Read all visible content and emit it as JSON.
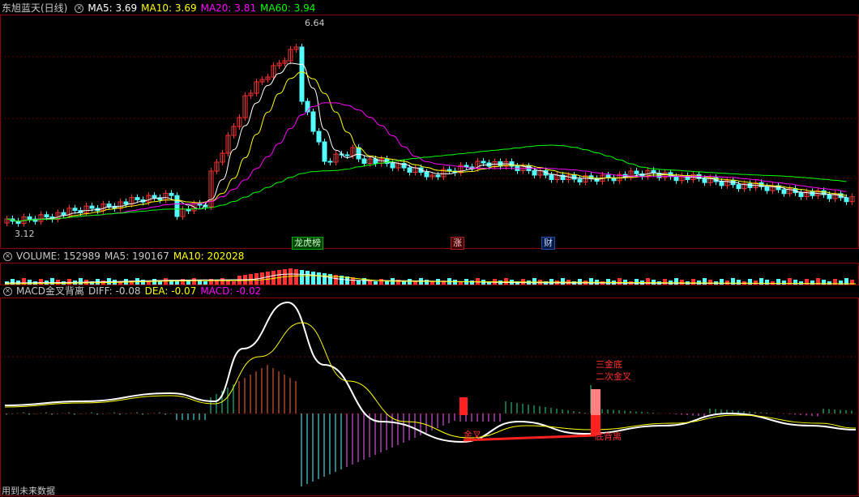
{
  "stock_name": "东旭蓝天(日线)",
  "price_panel": {
    "ma_labels": [
      {
        "name": "MA5:",
        "value": "3.69",
        "color": "#ffffff"
      },
      {
        "name": "MA10:",
        "value": "3.69",
        "color": "#ffff00"
      },
      {
        "name": "MA20:",
        "value": "3.81",
        "color": "#ff00ff"
      },
      {
        "name": "MA60:",
        "value": "3.94",
        "color": "#00ff00"
      }
    ],
    "high_label": "6.64",
    "low_label": "3.12",
    "event_tags": [
      {
        "text": "龙虎榜",
        "color": "#00aa00"
      },
      {
        "text": "涨",
        "color": "#ff4040"
      },
      {
        "text": "财",
        "color": "#4080ff"
      }
    ]
  },
  "volume_panel": {
    "title": "VOLUME:",
    "title_value": "152989",
    "ma5_label": "MA5:",
    "ma5_value": "190167",
    "ma10_label": "MA10:",
    "ma10_value": "202028"
  },
  "macd_panel": {
    "title": "MACD金叉背离",
    "diff_label": "DIFF:",
    "diff_value": "-0.08",
    "dea_label": "DEA:",
    "dea_value": "-0.07",
    "macd_label": "MACD:",
    "macd_value": "-0.02",
    "annotations": {
      "third_bottom": "三金底",
      "second_cross": "二次金叉",
      "golden_cross": "金叉",
      "bottom_divergence": "底背离"
    },
    "footer": "用到未来数据"
  },
  "colors": {
    "up": "#ff3232",
    "down": "#54ffff",
    "ma5": "#ffffff",
    "ma10": "#ffff00",
    "ma20": "#ff00ff",
    "ma60": "#00ff00",
    "grid": "#8b0000"
  }
}
